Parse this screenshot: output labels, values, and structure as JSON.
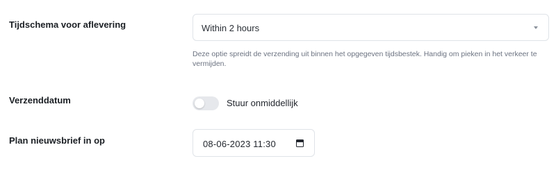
{
  "delivery_schedule": {
    "label": "Tijdschema voor aflevering",
    "selected": "Within 2 hours",
    "help": "Deze optie spreidt de verzending uit binnen het opgegeven tijdsbestek. Handig om pieken in het verkeer te vermijden."
  },
  "send_date": {
    "label": "Verzenddatum",
    "toggle_label": "Stuur onmiddellijk",
    "toggle_on": false
  },
  "plan": {
    "label": "Plan nieuwsbrief in op",
    "value": "08-06-2023 11:30"
  },
  "icons": {
    "dropdown": "chevron-down-icon",
    "calendar": "calendar-icon"
  }
}
